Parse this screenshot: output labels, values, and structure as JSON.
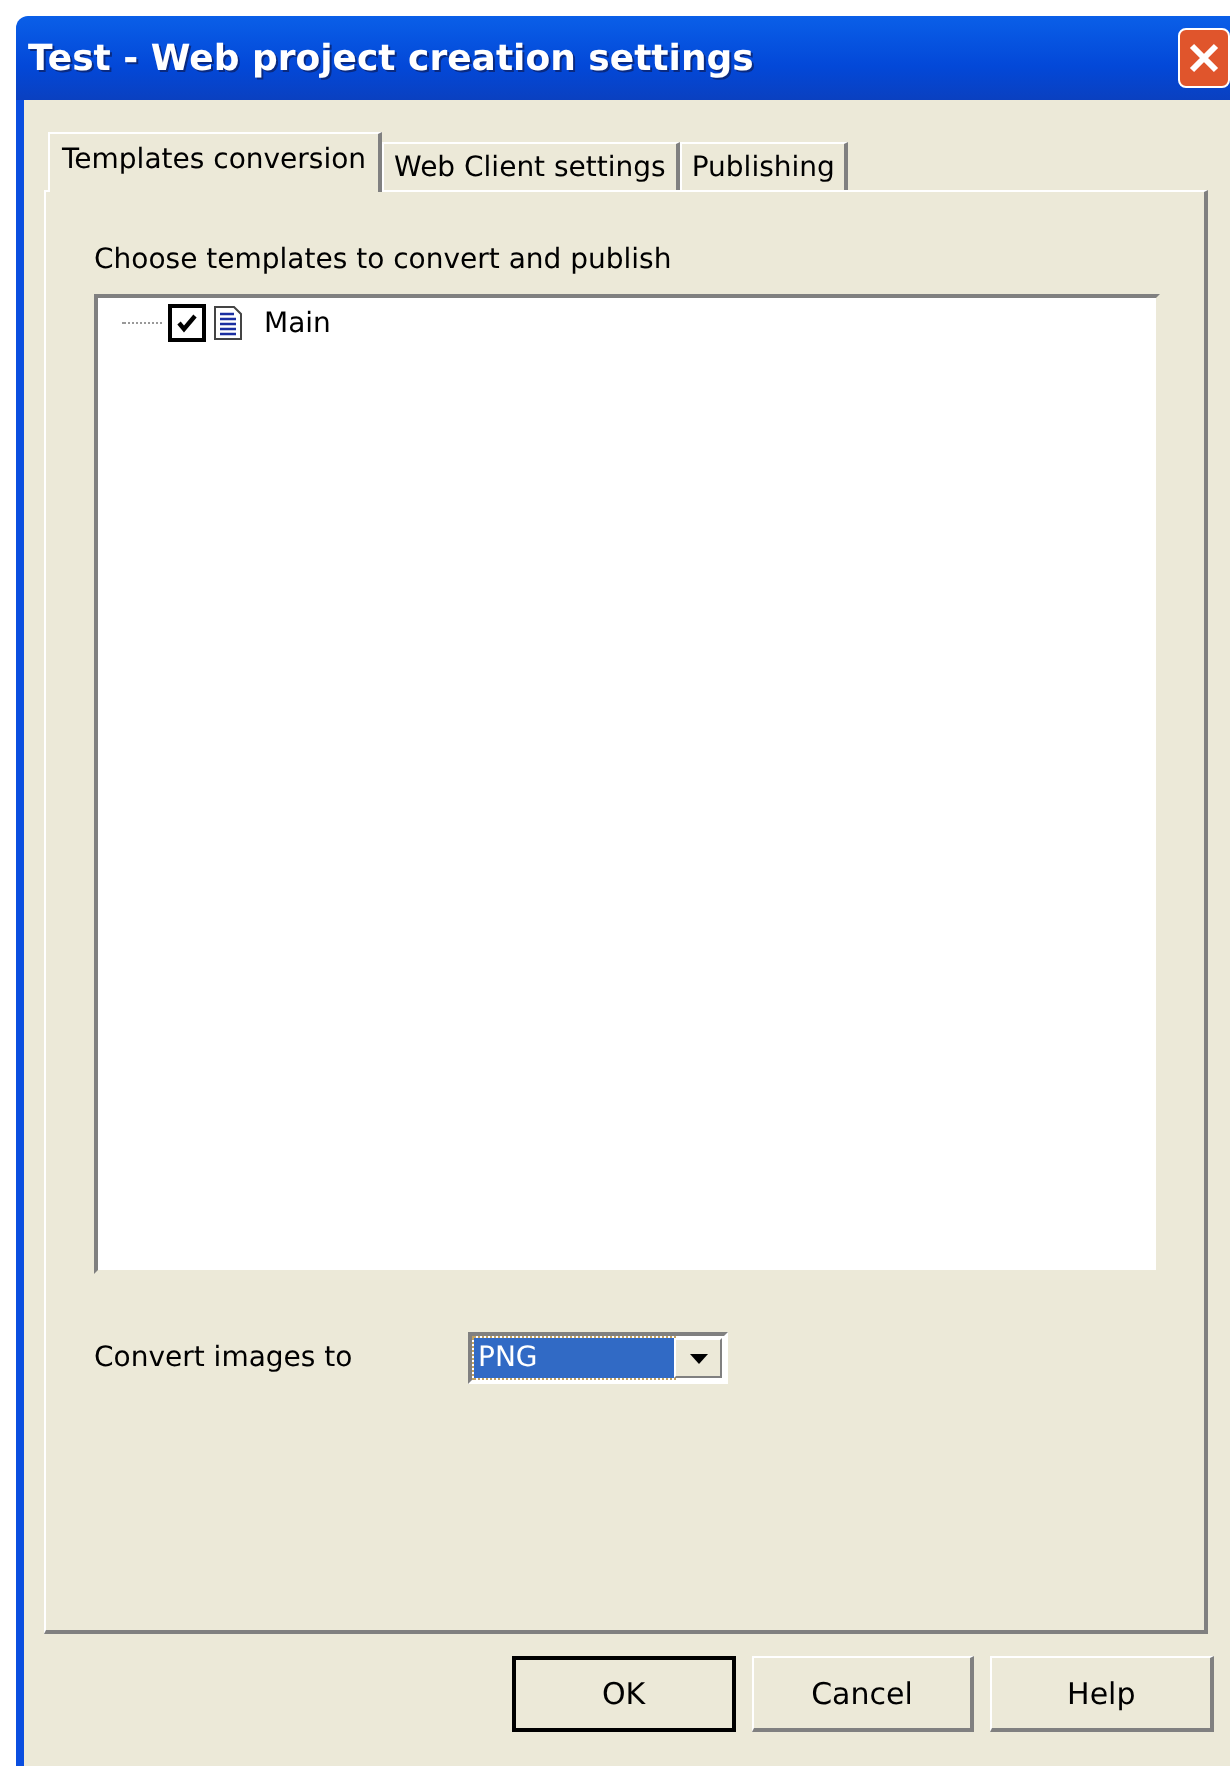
{
  "window": {
    "title": "Test - Web project creation settings"
  },
  "tabs": [
    {
      "label": "Templates conversion",
      "selected": true
    },
    {
      "label": "Web Client settings",
      "selected": false
    },
    {
      "label": "Publishing",
      "selected": false
    }
  ],
  "templates": {
    "label": "Choose templates to convert and publish",
    "items": [
      {
        "label": "Main",
        "checked": true
      }
    ]
  },
  "convert": {
    "label": "Convert images to",
    "value": "PNG"
  },
  "buttons": [
    {
      "label": "OK",
      "default": true
    },
    {
      "label": "Cancel",
      "default": false
    },
    {
      "label": "Help",
      "default": false
    }
  ]
}
